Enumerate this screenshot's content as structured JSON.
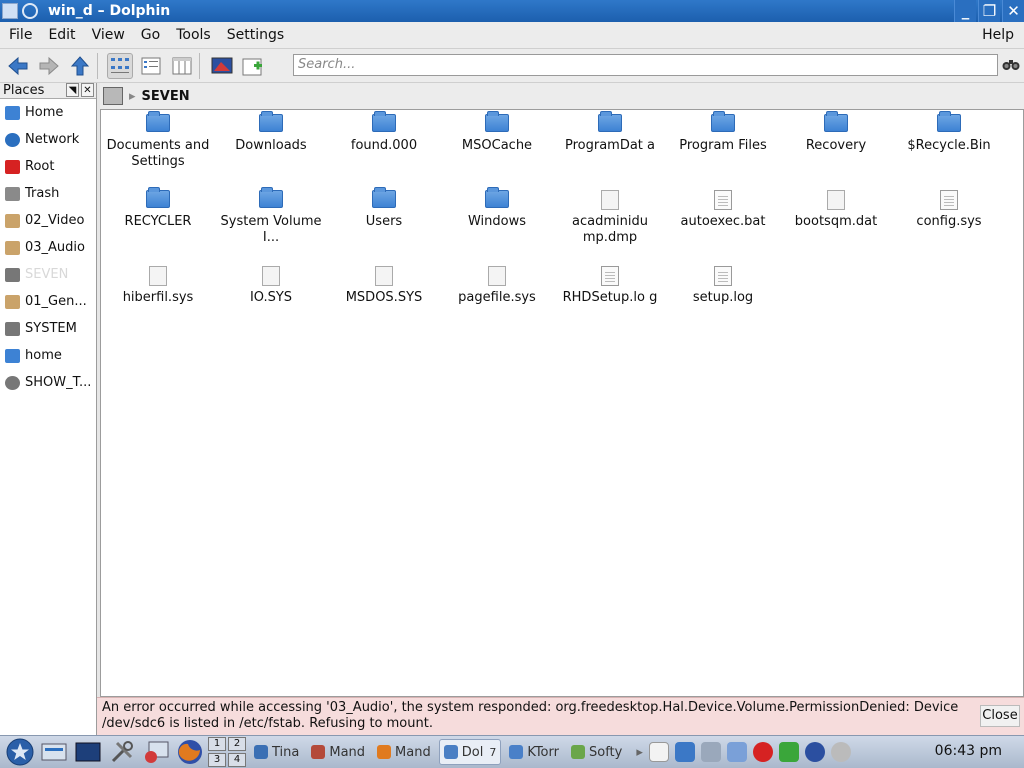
{
  "window": {
    "title": "win_d – Dolphin",
    "minimize": "_",
    "maximize": "❐",
    "close": "✕"
  },
  "menu": [
    "File",
    "Edit",
    "View",
    "Go",
    "Tools",
    "Settings"
  ],
  "help": "Help",
  "toolbar": {
    "search_placeholder": "Search..."
  },
  "places": {
    "title": "Places",
    "items": [
      {
        "label": "Home",
        "icon": "home-folder-icon",
        "color": "#3d82d4"
      },
      {
        "label": "Network",
        "icon": "network-globe-icon",
        "color": "#2b6fbf"
      },
      {
        "label": "Root",
        "icon": "root-folder-icon",
        "color": "#d62222"
      },
      {
        "label": "Trash",
        "icon": "trash-icon",
        "color": "#8a8a8a"
      },
      {
        "label": "02_Video",
        "icon": "usb-drive-icon",
        "color": "#caa36a"
      },
      {
        "label": "03_Audio",
        "icon": "usb-drive-icon",
        "color": "#caa36a"
      },
      {
        "label": "SEVEN",
        "icon": "hard-drive-icon",
        "color": "#777777"
      },
      {
        "label": "01_Gen...",
        "icon": "usb-drive-icon",
        "color": "#caa36a"
      },
      {
        "label": "SYSTEM",
        "icon": "hard-drive-icon",
        "color": "#777777"
      },
      {
        "label": "home",
        "icon": "home-folder-icon",
        "color": "#3d82d4"
      },
      {
        "label": "SHOW_T...",
        "icon": "optical-disc-icon",
        "color": "#777777"
      }
    ]
  },
  "breadcrumb": {
    "path": "SEVEN"
  },
  "files": [
    {
      "name": "Documents and Settings",
      "type": "folder"
    },
    {
      "name": "Downloads",
      "type": "folder"
    },
    {
      "name": "found.000",
      "type": "folder"
    },
    {
      "name": "MSOCache",
      "type": "folder"
    },
    {
      "name": "ProgramDat a",
      "type": "folder"
    },
    {
      "name": "Program Files",
      "type": "folder"
    },
    {
      "name": "Recovery",
      "type": "folder"
    },
    {
      "name": "$Recycle.Bin",
      "type": "folder"
    },
    {
      "name": "RECYCLER",
      "type": "folder"
    },
    {
      "name": "System Volume I...",
      "type": "folder"
    },
    {
      "name": "Users",
      "type": "folder"
    },
    {
      "name": "Windows",
      "type": "folder"
    },
    {
      "name": "acadminidu mp.dmp",
      "type": "binary"
    },
    {
      "name": "autoexec.bat",
      "type": "text"
    },
    {
      "name": "bootsqm.dat",
      "type": "binary"
    },
    {
      "name": "config.sys",
      "type": "text"
    },
    {
      "name": "hiberfil.sys",
      "type": "binary"
    },
    {
      "name": "IO.SYS",
      "type": "blank"
    },
    {
      "name": "MSDOS.SYS",
      "type": "blank"
    },
    {
      "name": "pagefile.sys",
      "type": "binary"
    },
    {
      "name": "RHDSetup.lo g",
      "type": "text"
    },
    {
      "name": "setup.log",
      "type": "text"
    }
  ],
  "error": {
    "message": "An error occurred while accessing '03_Audio', the system responded: org.freedesktop.Hal.Device.Volume.PermissionDenied: Device /dev/sdc6 is listed in /etc/fstab. Refusing to mount.",
    "close_label": "Close"
  },
  "taskbar": {
    "desktops": [
      "1",
      "2",
      "3",
      "4"
    ],
    "tasks": [
      {
        "label": "Tina",
        "icon": "app-icon",
        "color": "#3a6fb4"
      },
      {
        "label": "Mand",
        "icon": "app-icon",
        "color": "#b44a3a"
      },
      {
        "label": "Mand",
        "icon": "firefox-icon",
        "color": "#e07a1f"
      },
      {
        "label": "Dol",
        "icon": "dolphin-icon",
        "color": "#4a7fc4",
        "active": true,
        "count": "7"
      },
      {
        "label": "KTorr",
        "icon": "ktorrent-icon",
        "color": "#4a80c8"
      },
      {
        "label": "Softy",
        "icon": "software-icon",
        "color": "#6aa64a"
      }
    ],
    "clock": "06:43 pm"
  }
}
